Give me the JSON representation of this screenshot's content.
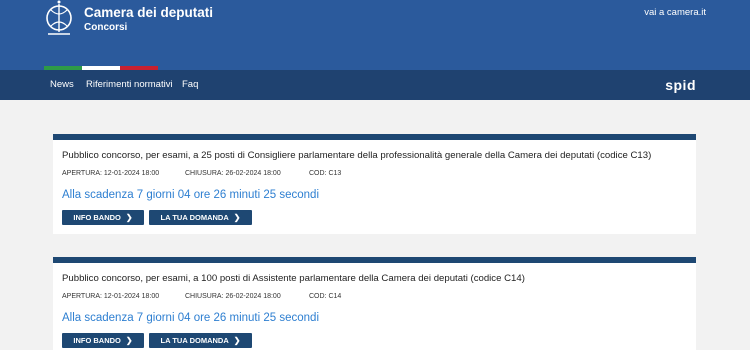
{
  "header": {
    "title": "Camera dei deputati",
    "subtitle": "Concorsi",
    "external_link": "vai a camera.it",
    "colors": {
      "header_bg": "#2b5a9c",
      "nav_bg": "#1f4270"
    }
  },
  "nav": {
    "items": [
      {
        "label": "News"
      },
      {
        "label": "Riferimenti normativi"
      },
      {
        "label": "Faq"
      }
    ],
    "spid_label": "spid"
  },
  "cards": [
    {
      "title": "Pubblico concorso, per esami, a 25 posti di Consigliere parlamentare della professionalità generale della Camera dei deputati (codice C13)",
      "apertura": "APERTURA: 12-01-2024 18:00",
      "chiusura": "CHIUSURA: 26-02-2024 18:00",
      "cod": "COD: C13",
      "countdown": "Alla scadenza 7 giorni 04 ore 26 minuti 25 secondi",
      "info_button": "INFO BANDO",
      "apply_button": "LA TUA DOMANDA"
    },
    {
      "title": "Pubblico concorso, per esami, a 100 posti di Assistente parlamentare della Camera dei deputati (codice C14)",
      "apertura": "APERTURA: 12-01-2024 18:00",
      "chiusura": "CHIUSURA: 26-02-2024 18:00",
      "cod": "COD: C14",
      "countdown": "Alla scadenza 7 giorni 04 ore 26 minuti 25 secondi",
      "info_button": "INFO BANDO",
      "apply_button": "LA TUA DOMANDA"
    }
  ],
  "icons": {
    "logo": "camera-emblem-icon",
    "button_chevron": "chevron-right-icon"
  },
  "colors": {
    "accent": "#2e7fd1",
    "button_bg": "#1e4873",
    "flag_green": "#2e9a47",
    "flag_white": "#ffffff",
    "flag_red": "#c8202f"
  }
}
